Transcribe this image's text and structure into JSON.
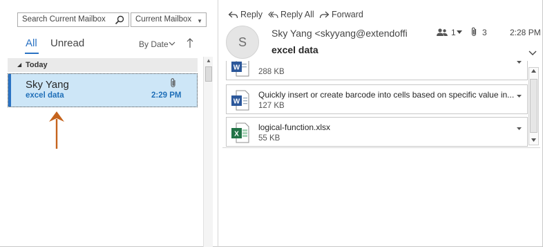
{
  "search": {
    "placeholder": "Search Current Mailbox",
    "scope": "Current Mailbox"
  },
  "filters": {
    "all": "All",
    "unread": "Unread",
    "sort": "By Date"
  },
  "group": {
    "label": "Today"
  },
  "mail_item": {
    "sender": "Sky Yang",
    "subject": "excel data",
    "time": "2:29 PM"
  },
  "actions": {
    "reply": "Reply",
    "reply_all": "Reply All",
    "forward": "Forward"
  },
  "message": {
    "avatar_initial": "S",
    "from": "Sky Yang <skyyang@extendoffi",
    "subject": "excel data",
    "people_count": "1",
    "attachment_count": "3",
    "time": "2:28 PM"
  },
  "attachments": [
    {
      "name": "",
      "size": "288 KB",
      "type": "word"
    },
    {
      "name": "Quickly insert or create barcode into cells based on specific value in...",
      "size": "127 KB",
      "type": "word"
    },
    {
      "name": "logical-function.xlsx",
      "size": "55 KB",
      "type": "excel"
    }
  ],
  "colors": {
    "accent": "#2a72c3",
    "selected_bg": "#cde6f7",
    "arrow": "#c5631c",
    "word": "#2b579a",
    "excel": "#217346"
  }
}
